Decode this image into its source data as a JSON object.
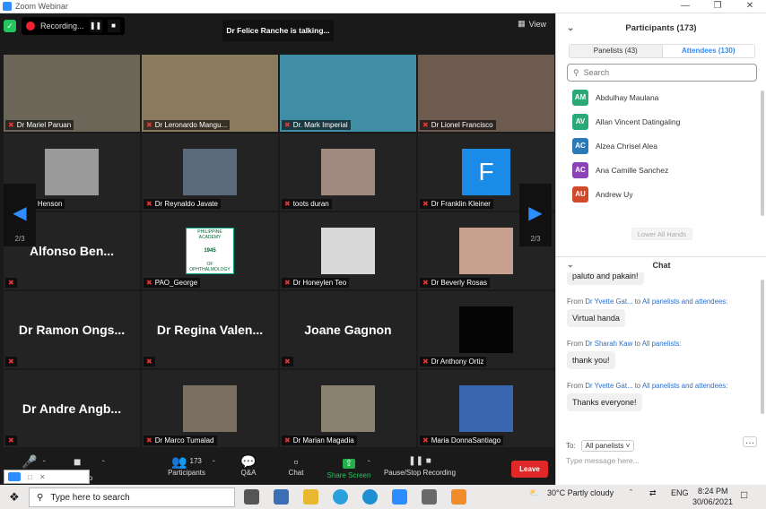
{
  "window": {
    "title": "Zoom Webinar"
  },
  "video": {
    "recording_label": "Recording...",
    "talking_banner": "Dr Felice Ranche is talking...",
    "view_label": "View",
    "page_indicator_left": "2/3",
    "page_indicator_right": "2/3",
    "tiles": [
      {
        "name": "Dr Mariel Paruan",
        "kind": "video",
        "bg": "#6b6658"
      },
      {
        "name": "Dr Leronardo Mangu...",
        "kind": "video",
        "bg": "#8a7a5e"
      },
      {
        "name": "Dr. Mark Imperial",
        "kind": "video",
        "bg": "#3f8ea6"
      },
      {
        "name": "Dr Lionel Francisco",
        "kind": "video",
        "bg": "#6d5b50"
      },
      {
        "name": "Raoul Henson",
        "kind": "photo",
        "bg": "#9a9a9a"
      },
      {
        "name": "Dr Reynaldo Javate",
        "kind": "photo",
        "bg": "#5a6a7a"
      },
      {
        "name": "toots duran",
        "kind": "photo",
        "bg": "#a08a80"
      },
      {
        "name": "Dr Franklin Kleiner",
        "kind": "letter",
        "letter": "F",
        "bg": "#1a8ce8"
      },
      {
        "name": "Alfonso Ben...",
        "kind": "text"
      },
      {
        "name": "PAO_George",
        "kind": "logo",
        "logo_top": "PHILIPPINE ACADEMY",
        "logo_year": "1945",
        "logo_bottom": "OF OPHTHALMOLOGY"
      },
      {
        "name": "Dr Honeylen Teo",
        "kind": "photo",
        "bg": "#d8d8d8"
      },
      {
        "name": "Dr Beverly Rosas",
        "kind": "photo",
        "bg": "#c8a090"
      },
      {
        "name": "Dr Ramon Ongs...",
        "kind": "text"
      },
      {
        "name": "Dr Regina Valen...",
        "kind": "text"
      },
      {
        "name": "Joane Gagnon",
        "kind": "text"
      },
      {
        "name": "Dr Anthony Ortiz",
        "kind": "photo",
        "bg": "#050505"
      },
      {
        "name": "Dr Andre Angb...",
        "kind": "text"
      },
      {
        "name": "Dr Marco Tumalad",
        "kind": "photo",
        "bg": "#7a6f60"
      },
      {
        "name": "Dr Marian Magadia",
        "kind": "photo",
        "bg": "#8a8070"
      },
      {
        "name": "Maria DonnaSantiago",
        "kind": "photo",
        "bg": "#3a66b0"
      }
    ]
  },
  "toolbar": {
    "video_label": "deo",
    "participants_count": "173",
    "participants_label": "Participants",
    "qa_label": "Q&A",
    "chat_label": "Chat",
    "share_label": "Share Screen",
    "record_label": "Pause/Stop Recording",
    "leave_label": "Leave"
  },
  "participants": {
    "title": "Participants (173)",
    "tab_panelists": "Panelists (43)",
    "tab_attendees": "Attendees (130)",
    "search_placeholder": "Search",
    "lower_hands": "Lower All Hands",
    "list": [
      {
        "initials": "AM",
        "name": "Abdulhay Maulana",
        "color": "#2aa876"
      },
      {
        "initials": "AV",
        "name": "Allan Vincent Datingaling",
        "color": "#2aa876"
      },
      {
        "initials": "AC",
        "name": "Alzea Chrisel Alea",
        "color": "#2a7ab8"
      },
      {
        "initials": "AC",
        "name": "Ana Camille Sanchez",
        "color": "#8a44b8"
      },
      {
        "initials": "AU",
        "name": "Andrew Uy",
        "color": "#d04a2a"
      }
    ]
  },
  "chat": {
    "title": "Chat",
    "partial_message": "paluto and pakain!",
    "messages": [
      {
        "from": "Dr Yvette Gat...",
        "to": "All panelists and attendees",
        "text": "Virtual handa"
      },
      {
        "from": "Dr Sharah Kaw",
        "to": "All panelists",
        "text": "thank you!"
      },
      {
        "from": "Dr Yvette Gat...",
        "to": "All panelists and attendees",
        "text": "Thanks everyone!"
      }
    ],
    "from_word": "From",
    "to_word": "to",
    "to_label": "To:",
    "to_value": "All panelists",
    "input_placeholder": "Type message here..."
  },
  "taskbar": {
    "search_placeholder": "Type here to search",
    "weather": "30°C  Partly cloudy",
    "lang": "ENG",
    "time": "8:24 PM",
    "date": "30/06/2021"
  }
}
